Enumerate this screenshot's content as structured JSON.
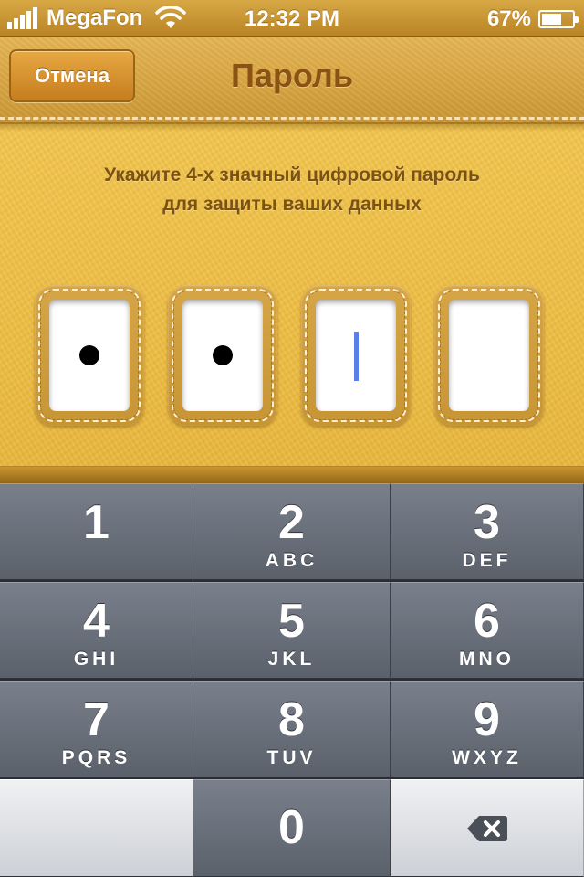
{
  "status_bar": {
    "carrier": "MegaFon",
    "time": "12:32 PM",
    "battery_percent": "67%",
    "battery_level": 0.67,
    "signal_bars": 5
  },
  "nav": {
    "cancel_label": "Отмена",
    "title": "Пароль"
  },
  "instruction": {
    "line1": "Укажите 4-х значный цифровой пароль",
    "line2": "для защиты ваших данных"
  },
  "pin": {
    "length": 4,
    "filled": 2,
    "cursor_index": 2
  },
  "keypad": {
    "keys": [
      {
        "digit": "1",
        "letters": ""
      },
      {
        "digit": "2",
        "letters": "ABC"
      },
      {
        "digit": "3",
        "letters": "DEF"
      },
      {
        "digit": "4",
        "letters": "GHI"
      },
      {
        "digit": "5",
        "letters": "JKL"
      },
      {
        "digit": "6",
        "letters": "MNO"
      },
      {
        "digit": "7",
        "letters": "PQRS"
      },
      {
        "digit": "8",
        "letters": "TUV"
      },
      {
        "digit": "9",
        "letters": "WXYZ"
      },
      {
        "digit": "0",
        "letters": ""
      }
    ],
    "delete_icon": "backspace-icon"
  },
  "colors": {
    "leather": "#f0c048",
    "nav_title": "#8a5213",
    "cursor": "#5a7fe8",
    "key_dark": "#5b616b",
    "key_light": "#e4e6ea"
  }
}
